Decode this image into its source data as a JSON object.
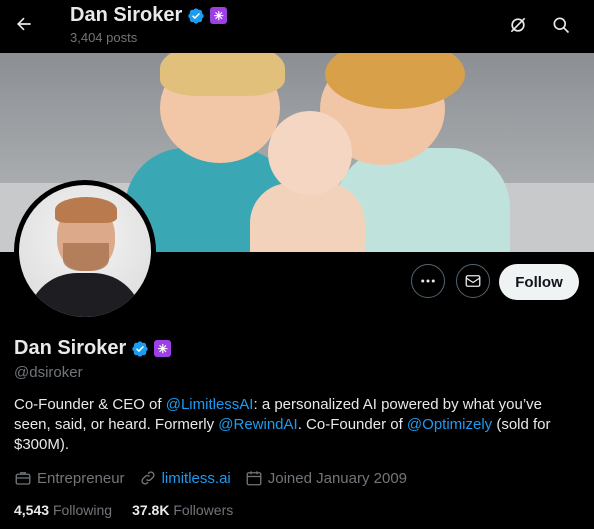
{
  "header": {
    "name": "Dan Siroker",
    "posts": "3,404 posts",
    "icons": [
      "back-arrow-icon",
      "grok-icon",
      "search-icon"
    ]
  },
  "profile": {
    "name": "Dan Siroker",
    "handle": "@dsiroker",
    "bio_parts": {
      "p1": "Co-Founder & CEO of ",
      "link1": "@LimitlessAI",
      "p2": ": a personalized AI powered by what you’ve seen, said, or heard. Formerly ",
      "link2": "@RewindAI",
      "p3": ". Co-Founder of ",
      "link3": "@Optimizely",
      "p4": " (sold for $300M)."
    },
    "category": "Entrepreneur",
    "website": "limitless.ai",
    "joined": "Joined January 2009",
    "following_count": "4,543",
    "following_label": "Following",
    "followers_count": "37.8K",
    "followers_label": "Followers"
  },
  "actions": {
    "follow_label": "Follow"
  },
  "colors": {
    "background": "#000000",
    "link": "#1d9bf0",
    "muted": "#71767b",
    "affiliate_badge": "#9c3fe4"
  }
}
